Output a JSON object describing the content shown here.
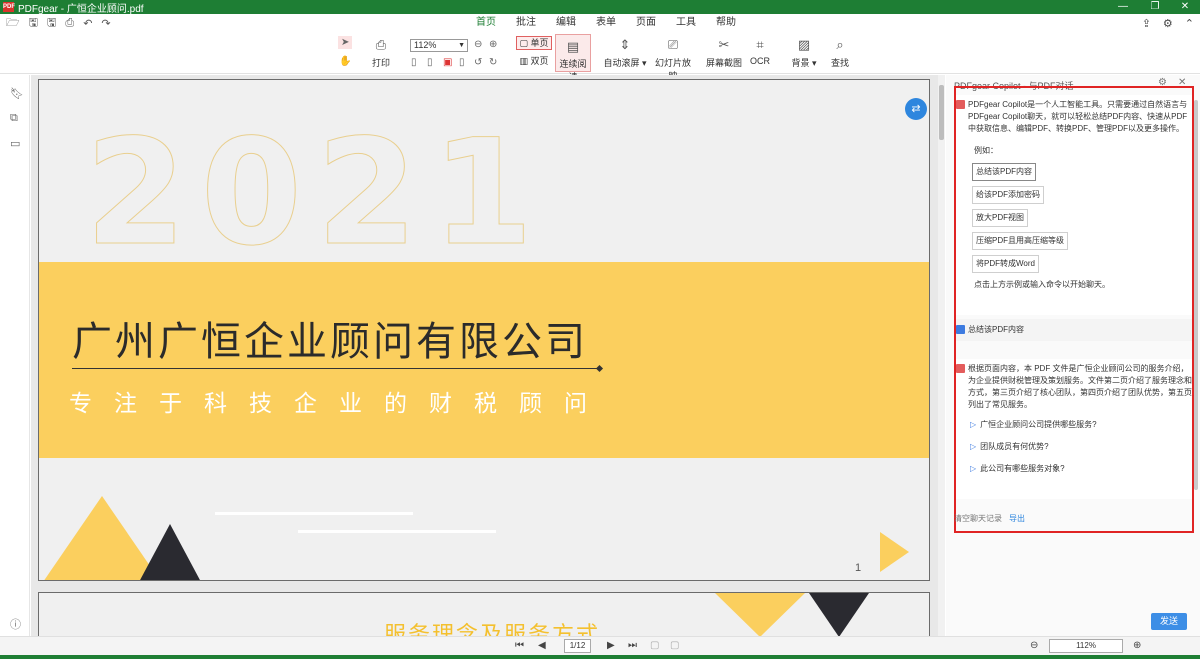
{
  "window": {
    "title": "PDFgear - 广恒企业顾问.pdf",
    "logo_text": "PDF",
    "controls": [
      "—",
      "❐",
      "✕"
    ]
  },
  "quick_access": [
    "🗁",
    "🖫",
    "🖫",
    "⎙",
    "↶",
    "↷"
  ],
  "tabs": [
    "首页",
    "批注",
    "编辑",
    "表单",
    "页面",
    "工具",
    "帮助"
  ],
  "ribbon": {
    "print": "打印",
    "zoom_value": "112%",
    "single_page": "单页",
    "double_page": "双页",
    "continuous": "连续阅读",
    "auto_scroll": "自动滚屏",
    "slideshow": "幻灯片放映",
    "screenshot": "屏幕截图",
    "ocr": "OCR",
    "background": "背景",
    "find": "查找"
  },
  "document": {
    "year": "2021",
    "company": "广州广恒企业顾问有限公司",
    "slogan": "专注于科技企业的财税顾问",
    "page_number": "1",
    "page2_title": "服务理念及服务方式"
  },
  "copilot": {
    "header": "PDFgear Copilot - 与PDF对话",
    "intro": [
      "PDFgear Copilot是一个人工智能工具。只需要通过自然语言与",
      "PDFgear Copilot聊天，就可以轻松总结PDF内容、快速从PDF",
      "中获取信息、编辑PDF、转换PDF、管理PDF以及更多操作。"
    ],
    "example_label": "例如：",
    "suggestions": [
      "总结该PDF内容",
      "给该PDF添加密码",
      "放大PDF视图",
      "压缩PDF且用高压缩等级",
      "将PDF转成Word"
    ],
    "hint": "点击上方示例或输入命令以开始聊天。",
    "user_message": "总结该PDF内容",
    "answer": [
      "根据页面内容，本 PDF 文件是广恒企业顾问公司的服务介绍，",
      "为企业提供财税管理及策划服务。文件第二页介绍了服务理念和",
      "方式，第三页介绍了核心团队，第四页介绍了团队优势，第五页",
      "列出了常见服务。"
    ],
    "questions": [
      "广恒企业顾问公司提供哪些服务?",
      "团队成员有何优势?",
      "此公司有哪些服务对象?"
    ],
    "clear_history": "清空聊天记录",
    "export": "导出",
    "send": "发送"
  },
  "statusbar": {
    "page_field": "1",
    "page_total": "/12",
    "zoom": "112%"
  }
}
